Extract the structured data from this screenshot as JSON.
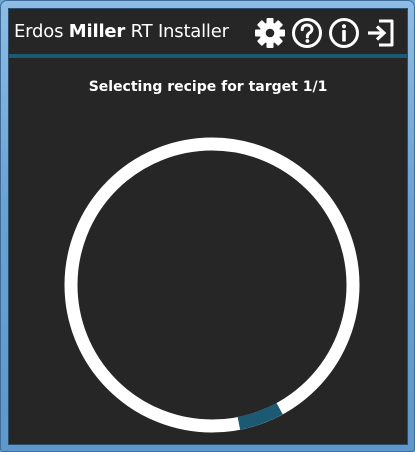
{
  "window": {
    "title_prefix": "Erdos ",
    "title_bold": "Miller",
    "title_suffix": " RT Installer"
  },
  "toolbar": {
    "buttons": [
      {
        "name": "settings",
        "icon": "gear-icon"
      },
      {
        "name": "help",
        "icon": "question-icon"
      },
      {
        "name": "info",
        "icon": "info-icon"
      },
      {
        "name": "exit",
        "icon": "sign-in-icon"
      }
    ]
  },
  "status": {
    "text": "Selecting recipe for target 1/1"
  },
  "progress": {
    "type": "indeterminate-ring",
    "ring_color": "#ffffff",
    "accent_color": "#1c5a73"
  },
  "colors": {
    "background": "#262626",
    "accent": "#1c5a73",
    "text": "#ffffff"
  }
}
